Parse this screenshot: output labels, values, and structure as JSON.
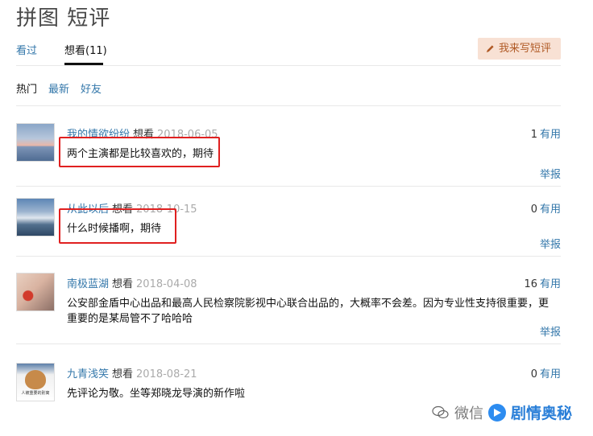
{
  "page": {
    "title": "拼图 短评"
  },
  "tabs": [
    {
      "label": "看过"
    },
    {
      "label": "想看(11)"
    }
  ],
  "write_button": {
    "label": "我来写短评"
  },
  "filters": [
    {
      "label": "热门"
    },
    {
      "label": "最新"
    },
    {
      "label": "好友"
    }
  ],
  "reviews": [
    {
      "user": "我的情欲纷纷",
      "action": "想看",
      "date": "2018-06-05",
      "votes": "1",
      "useful": "有用",
      "content": "两个主演都是比较喜欢的，期待",
      "report": "举报"
    },
    {
      "user": "从此以后",
      "action": "想看",
      "date": "2018-10-15",
      "votes": "0",
      "useful": "有用",
      "content": "什么时候播啊，期待",
      "report": "举报"
    },
    {
      "user": "南极蓝湖",
      "action": "想看",
      "date": "2018-04-08",
      "votes": "16",
      "useful": "有用",
      "content": "公安部金盾中心出品和最高人民检察院影视中心联合出品的，大概率不会差。因为专业性支持很重要，更重要的是某局管不了哈哈哈",
      "report": "举报"
    },
    {
      "user": "九青浅笑",
      "action": "想看",
      "date": "2018-08-21",
      "votes": "0",
      "useful": "有用",
      "content": "先评论为敬。坐等郑晓龙导演的新作啦",
      "avatar_caption": "人被重要的别离"
    }
  ],
  "watermark": {
    "wechat": "微信",
    "brand": "剧情奥秘"
  },
  "colors": {
    "link": "#3377aa",
    "highlight": "#e02020",
    "button_bg": "#f8e1d4",
    "button_text": "#b05a26"
  },
  "icons": [
    "pencil-icon",
    "wechat-icon",
    "play-logo-icon"
  ]
}
